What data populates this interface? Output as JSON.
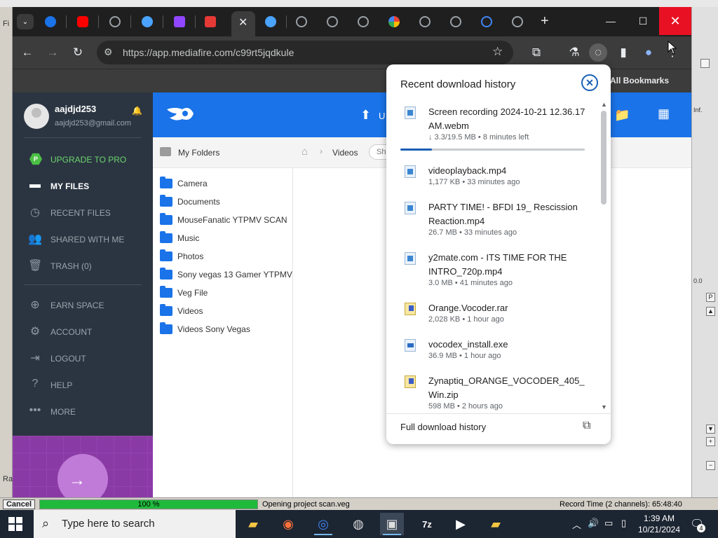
{
  "background_app": {
    "left_labels": [
      "Fi",
      "Ra"
    ],
    "right_labels": [
      "Inf.",
      "0.0",
      "P"
    ],
    "cancel_label": "Cancel",
    "progress_percent": 100,
    "progress_label": "100 %",
    "status_text": "Opening project scan.veg",
    "record_time": "Record Time (2 channels): 65:48:40"
  },
  "window": {
    "minimize": "—",
    "maximize": "☐",
    "close": "✕"
  },
  "tabs": [
    {
      "icon": "generic-globe-icon",
      "color": "#8ab4f8"
    },
    {
      "icon": "youtube-icon",
      "color": "#ff0000"
    },
    {
      "icon": "generic-globe-icon",
      "color": "#9aa0a6"
    },
    {
      "icon": "mediafire-icon",
      "color": "#1a73e8"
    },
    {
      "icon": "twitch-icon",
      "color": "#9146ff"
    },
    {
      "icon": "download-icon",
      "color": "#e53935"
    }
  ],
  "toolbar": {
    "url": "https://app.mediafire.com/c99rt5jqdkule",
    "bookmarks_label": "All Bookmarks"
  },
  "mediafire": {
    "username": "aajdjd253",
    "email": "aajdjd253@gmail.com",
    "menu": [
      {
        "label": "UPGRADE TO PRO",
        "icon": "pro-hex-icon"
      },
      {
        "label": "MY FILES",
        "icon": "folder-icon"
      },
      {
        "label": "RECENT FILES",
        "icon": "clock-icon"
      },
      {
        "label": "SHARED WITH ME",
        "icon": "people-icon"
      },
      {
        "label": "TRASH (0)",
        "icon": "trash-icon"
      },
      {
        "label": "EARN SPACE",
        "icon": "plus-circle-icon"
      },
      {
        "label": "ACCOUNT",
        "icon": "gear-icon"
      },
      {
        "label": "LOGOUT",
        "icon": "logout-icon"
      },
      {
        "label": "HELP",
        "icon": "help-icon"
      },
      {
        "label": "MORE",
        "icon": "more-icon"
      }
    ],
    "upload_label": "U",
    "my_folders_label": "My Folders",
    "folders": [
      "Camera",
      "Documents",
      "MouseFanatic YTPMV SCAN",
      "Music",
      "Photos",
      "Sony vegas 13 Gamer YTPMV",
      "Veg File",
      "Videos",
      "Videos Sony Vegas"
    ],
    "breadcrumb": "Videos",
    "breadcrumb_pill": "Sh"
  },
  "downloads": {
    "title": "Recent download history",
    "items": [
      {
        "name": "Screen recording 2024-10-21 12.36.17 AM.webm",
        "meta": "↓ 3.3/19.5 MB • 8 minutes left",
        "type": "video",
        "progress": 0.17
      },
      {
        "name": "videoplayback.mp4",
        "meta": "1,177 KB • 33 minutes ago",
        "type": "video"
      },
      {
        "name": "PARTY TIME! - BFDI 19_ Rescission Reaction.mp4",
        "meta": "26.7 MB • 33 minutes ago",
        "type": "video"
      },
      {
        "name": "y2mate.com - ITS TIME FOR THE INTRO_720p.mp4",
        "meta": "3.0 MB • 41 minutes ago",
        "type": "video"
      },
      {
        "name": "Orange.Vocoder.rar",
        "meta": "2,028 KB • 1 hour ago",
        "type": "archive"
      },
      {
        "name": "vocodex_install.exe",
        "meta": "36.9 MB • 1 hour ago",
        "type": "exe"
      },
      {
        "name": "Zynaptiq_ORANGE_VOCODER_405_Win.zip",
        "meta": "598 MB • 2 hours ago",
        "type": "archive"
      }
    ],
    "footer_label": "Full download history"
  },
  "taskbar": {
    "search_placeholder": "Type here to search",
    "time": "1:39 AM",
    "date": "10/21/2024",
    "notification_count": "4"
  }
}
